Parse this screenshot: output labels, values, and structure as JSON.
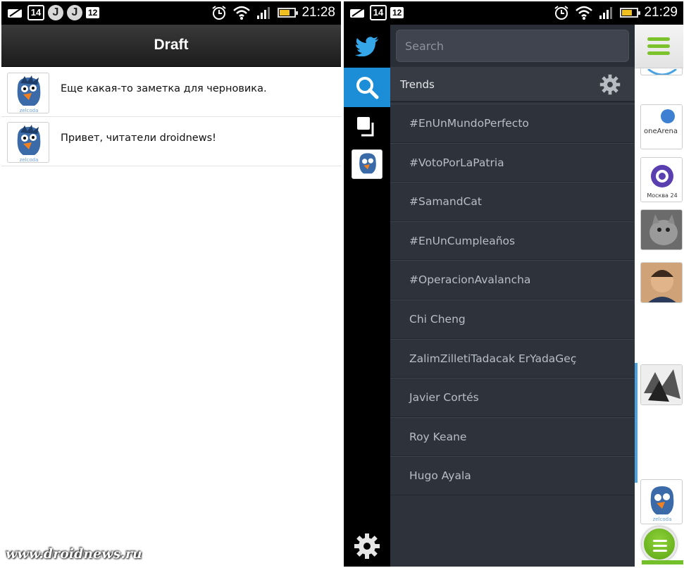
{
  "left_screen": {
    "status": {
      "date": "14",
      "msg_count": "12",
      "app_icon_letter": "J",
      "time": "21:28"
    },
    "header": {
      "title": "Draft"
    },
    "drafts": [
      {
        "avatar_label": "zelcoda",
        "text": "Еще какая-то заметка для черновика."
      },
      {
        "avatar_label": "zelcoda",
        "text": "Привет, читатели droidnews!"
      }
    ],
    "watermark": "www.droidnews.ru"
  },
  "right_screen": {
    "status": {
      "date": "14",
      "msg_count": "12",
      "time": "21:29"
    },
    "rail": {
      "items": [
        {
          "name": "twitter-bird-icon"
        },
        {
          "name": "search-icon",
          "active": true
        },
        {
          "name": "windows-icon"
        },
        {
          "name": "avatar"
        }
      ],
      "bottom": "gear-icon"
    },
    "search": {
      "placeholder": "Search"
    },
    "trends": {
      "title": "Trends",
      "items": [
        "#EnUnMundoPerfecto",
        "#VotoPorLaPatria",
        "#SamandCat",
        "#EnUnCumpleaños",
        "#OperacionAvalancha",
        "Chi Cheng",
        "ZalimZilletiTadacak ErYadaGeç",
        "Javier Cortés",
        "Roy Keane",
        "Hugo Ayala"
      ]
    },
    "timeline": {
      "avatars": [
        {
          "name": "oneArena",
          "label": "oneArena"
        },
        {
          "name": "moskva24",
          "label": "Москва 24"
        },
        {
          "name": "cat"
        },
        {
          "name": "man"
        },
        {
          "name": "artwork"
        },
        {
          "name": "zelcoda",
          "label": "zelcoda"
        }
      ]
    },
    "colors": {
      "accent": "#1c8ed8",
      "green": "#7cc22b",
      "panel": "#2d323b"
    }
  }
}
